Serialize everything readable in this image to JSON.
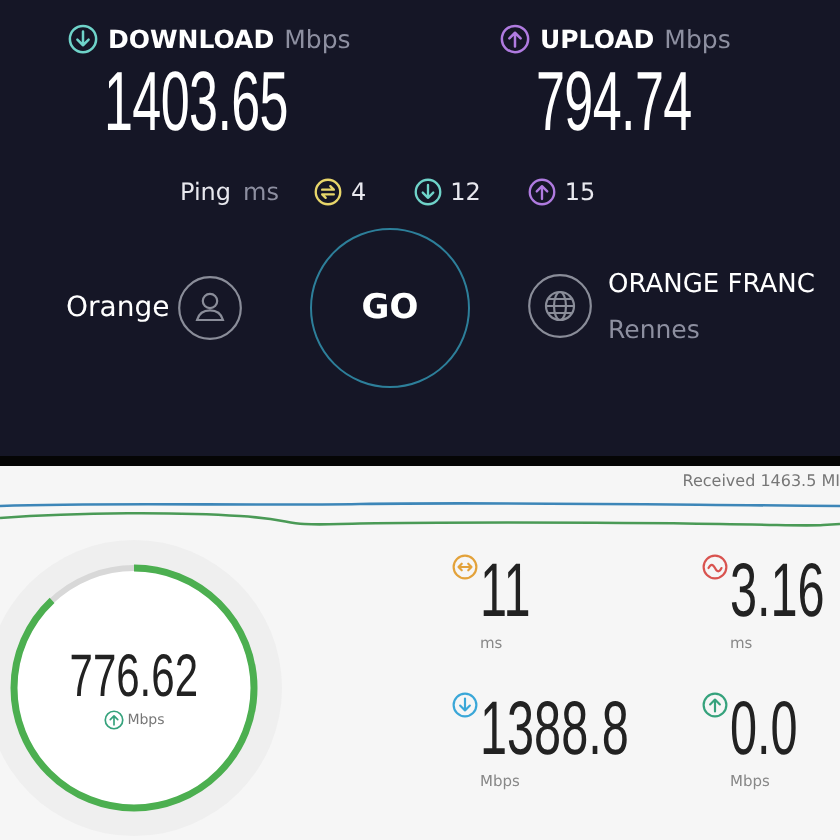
{
  "speedtest": {
    "results": [
      {
        "kind": "download",
        "label": "DOWNLOAD",
        "unit": "Mbps",
        "value": "1403.65"
      },
      {
        "kind": "upload",
        "label": "UPLOAD",
        "unit": "Mbps",
        "value": "794.74"
      }
    ],
    "ping": {
      "label": "Ping",
      "unit": "ms",
      "values": [
        {
          "kind": "idle",
          "value": "4"
        },
        {
          "kind": "download",
          "value": "12"
        },
        {
          "kind": "upload",
          "value": "15"
        }
      ]
    },
    "provider": {
      "name": "Orange"
    },
    "go_button": "GO",
    "server": {
      "name": "ORANGE FRANC",
      "location": "Rennes"
    }
  },
  "test_panel": {
    "received": "Received 1463.5 MI",
    "gauge": {
      "value": "776.62",
      "unit": "Mbps",
      "level": 0.88
    },
    "stats": [
      {
        "kind": "latency",
        "value": "11",
        "unit": "ms"
      },
      {
        "kind": "jitter",
        "value": "3.16",
        "unit": "ms"
      },
      {
        "kind": "download",
        "value": "1388.8",
        "unit": "Mbps"
      },
      {
        "kind": "upload",
        "value": "0.0",
        "unit": "Mbps"
      }
    ]
  }
}
